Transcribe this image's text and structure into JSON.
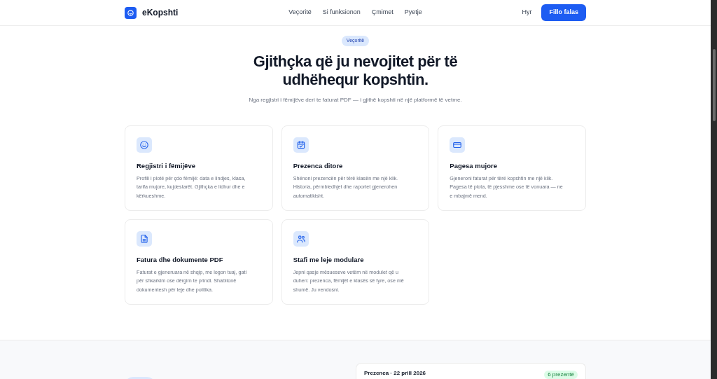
{
  "header": {
    "logo": "eKopshti",
    "nav": [
      {
        "label": "Veçoritë"
      },
      {
        "label": "Si funksionon"
      },
      {
        "label": "Çmimet"
      },
      {
        "label": "Pyetje"
      }
    ],
    "login": "Hyr",
    "cta": "Fillo falas"
  },
  "features": {
    "badge": "Veçoritë",
    "title_lines": [
      "Gjithçka që ju nevojitet për të",
      "udhëhequr kopshtin."
    ],
    "subtitle": "Nga regjistri i fëmijëve deri te faturat PDF — i gjithë kopshti në një platformë të vetme.",
    "cards": [
      {
        "kind": "smile",
        "title": "Regjistri i fëmijëve",
        "text": "Profili i plotë për çdo fëmijë: data e lindjes, klasa, tarifa mujore, kujdestarët. Gjithçka e lidhur dhe e kërkueshme."
      },
      {
        "kind": "calendar",
        "title": "Prezenca ditore",
        "text": "Shënoni prezencën për tërë klasën me një klik. Historia, përmbledhjet dhe raportet gjenerohen automatikisht."
      },
      {
        "kind": "card",
        "title": "Pagesa mujore",
        "text": "Gjeneroni faturat për tërë kopshtin me një klik. Pagesa të plota, të pjesshme ose të vonuara — ne e mbajmë mend."
      },
      {
        "kind": "file",
        "title": "Fatura dhe dokumente PDF",
        "text": "Faturat e gjeneruara në shqip, me logon tuaj, gati për shkarkim ose dërgim te prindi. Shabllonë dokumentesh për leje dhe politika."
      },
      {
        "kind": "users",
        "title": "Stafi me leje modulare",
        "text": "Jepni qasje mësueseve vetëm në modulet që u duhen: prezenca, fëmijët e klasës së tyre, ose më shumë. Ju vendosni."
      }
    ]
  },
  "preview": {
    "title": "Prezenca · 22 prill 2026",
    "badge": "6 prezentë"
  }
}
